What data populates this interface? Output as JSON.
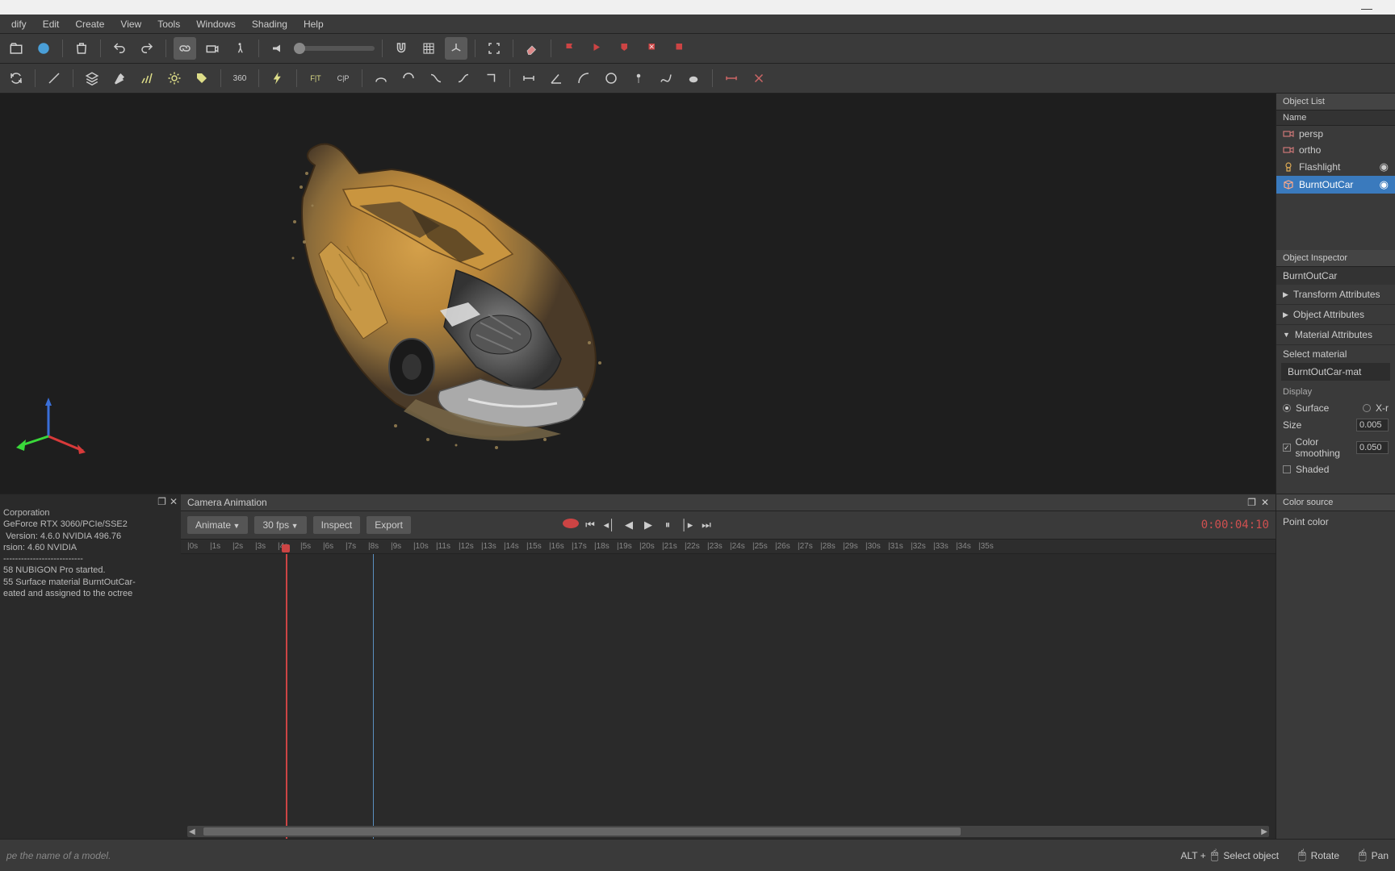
{
  "menubar": [
    "dify",
    "Edit",
    "Create",
    "View",
    "Tools",
    "Windows",
    "Shading",
    "Help"
  ],
  "object_list": {
    "title": "Object List",
    "col": "Name",
    "items": [
      {
        "name": "persp",
        "icon": "camera",
        "sel": false,
        "vis": false
      },
      {
        "name": "ortho",
        "icon": "camera",
        "sel": false,
        "vis": false
      },
      {
        "name": "Flashlight",
        "icon": "light",
        "sel": false,
        "vis": true
      },
      {
        "name": "BurntOutCar",
        "icon": "mesh",
        "sel": true,
        "vis": true
      }
    ]
  },
  "inspector": {
    "title": "Object Inspector",
    "obj": "BurntOutCar",
    "sections": [
      {
        "label": "Transform Attributes",
        "open": false
      },
      {
        "label": "Object Attributes",
        "open": false
      },
      {
        "label": "Material Attributes",
        "open": true
      }
    ],
    "material": {
      "select_lbl": "Select material",
      "mat_name": "BurntOutCar-mat",
      "display_lbl": "Display",
      "surface_lbl": "Surface",
      "xr_lbl": "X-r",
      "size_lbl": "Size",
      "size_val": "0.005",
      "smooth_lbl": "Color smoothing",
      "smooth_val": "0.050",
      "shaded_lbl": "Shaded"
    }
  },
  "color_source": {
    "title": "Color source",
    "pt": "Point color"
  },
  "console": {
    "lines": "Corporation\nGeForce RTX 3060/PCIe/SSE2\n Version: 4.6.0 NVIDIA 496.76\nrsion: 4.60 NVIDIA\n---------------------------\n58 NUBIGON Pro started.\n55 Surface material BurntOutCar-\neated and assigned to the octree"
  },
  "animation": {
    "title": "Camera Animation",
    "animate_btn": "Animate",
    "fps": "30 fps",
    "inspect": "Inspect",
    "export": "Export",
    "timecode": "0:00:04:10",
    "ticks": [
      "0s",
      "1s",
      "2s",
      "3s",
      "4s",
      "5s",
      "6s",
      "7s",
      "8s",
      "9s",
      "10s",
      "11s",
      "12s",
      "13s",
      "14s",
      "15s",
      "16s",
      "17s",
      "18s",
      "19s",
      "20s",
      "21s",
      "22s",
      "23s",
      "24s",
      "25s",
      "26s",
      "27s",
      "28s",
      "29s",
      "30s",
      "31s",
      "32s",
      "33s",
      "34s",
      "35s"
    ],
    "playhead_pos": "130px",
    "loop_pos": "238px"
  },
  "status": {
    "hint": "pe the name of a model.",
    "alt": "ALT +",
    "sel": "Select object",
    "rot": "Rotate",
    "pan": "Pan"
  }
}
